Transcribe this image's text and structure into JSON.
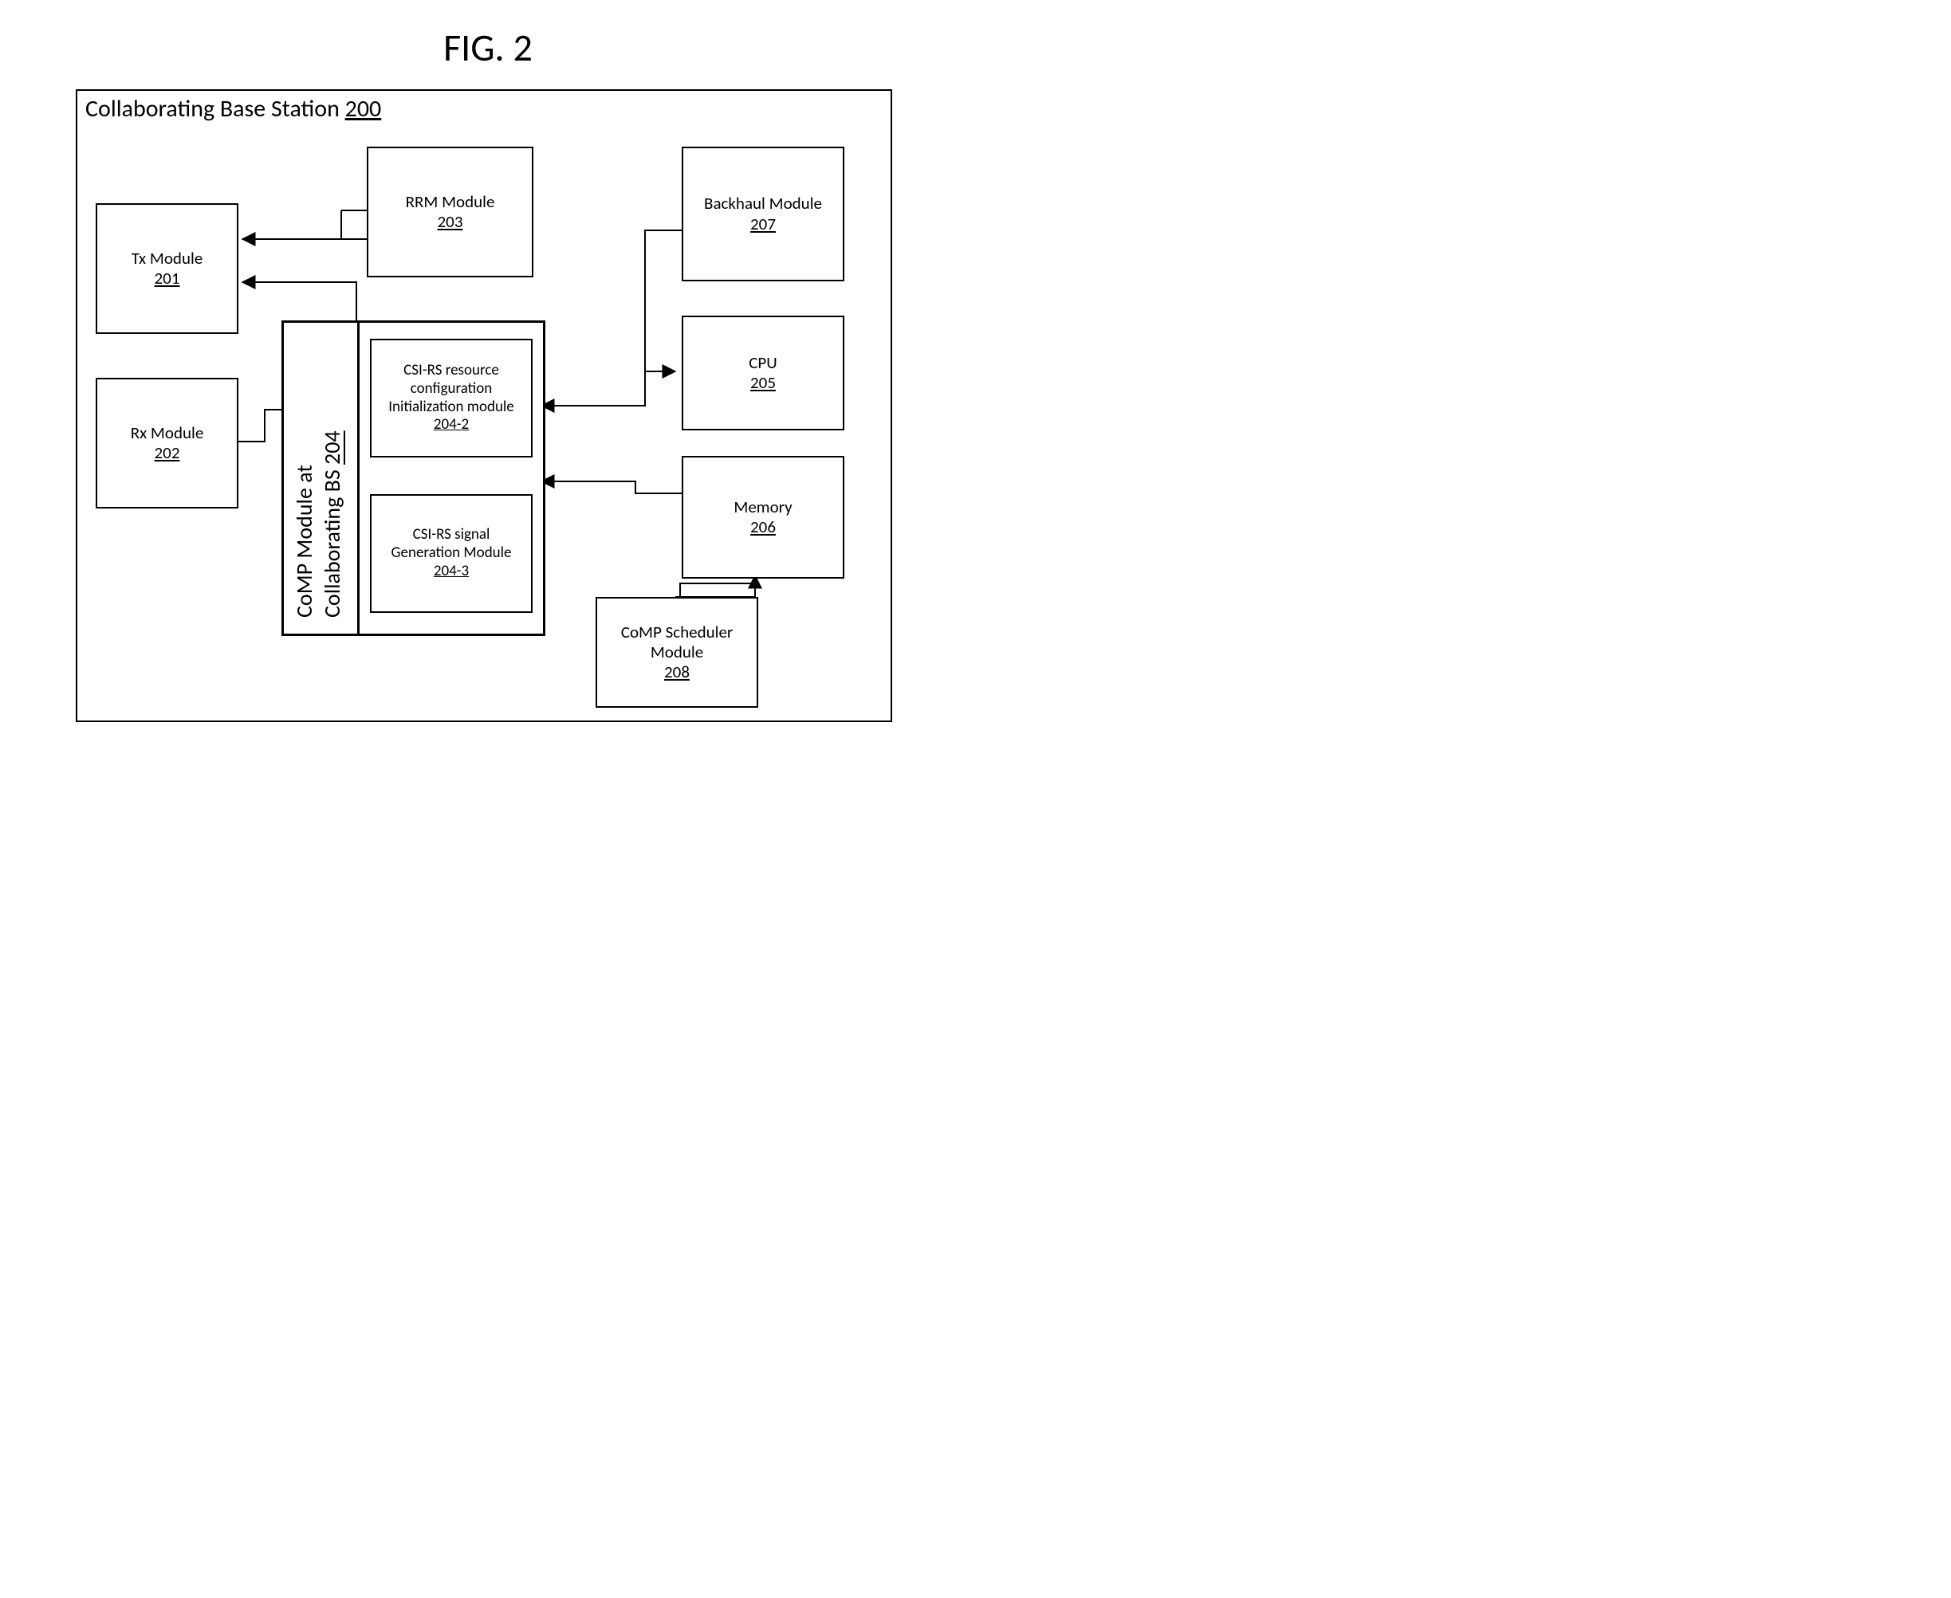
{
  "figure": {
    "title": "FIG. 2"
  },
  "outer": {
    "title_text": "Collaborating Base Station ",
    "title_num": "200"
  },
  "blocks": {
    "tx": {
      "label": "Tx Module",
      "num": "201"
    },
    "rx": {
      "label": "Rx Module",
      "num": "202"
    },
    "rrm": {
      "label": "RRM Module",
      "num": "203"
    },
    "comp": {
      "label1": "CoMP Module at",
      "label2": "Collaborating BS ",
      "num": "204"
    },
    "csi_cfg": {
      "line1": "CSI-RS resource",
      "line2": "configuration",
      "line3": "Initialization module",
      "num": "204-2"
    },
    "csi_gen": {
      "line1": "CSI-RS signal",
      "line2": "Generation Module",
      "num": "204-3"
    },
    "cpu": {
      "label": "CPU",
      "num": "205"
    },
    "mem": {
      "label": "Memory",
      "num": "206"
    },
    "backhaul": {
      "label": "Backhaul Module",
      "num": "207"
    },
    "sched": {
      "line1": "CoMP Scheduler",
      "line2": "Module",
      "num": "208"
    }
  }
}
